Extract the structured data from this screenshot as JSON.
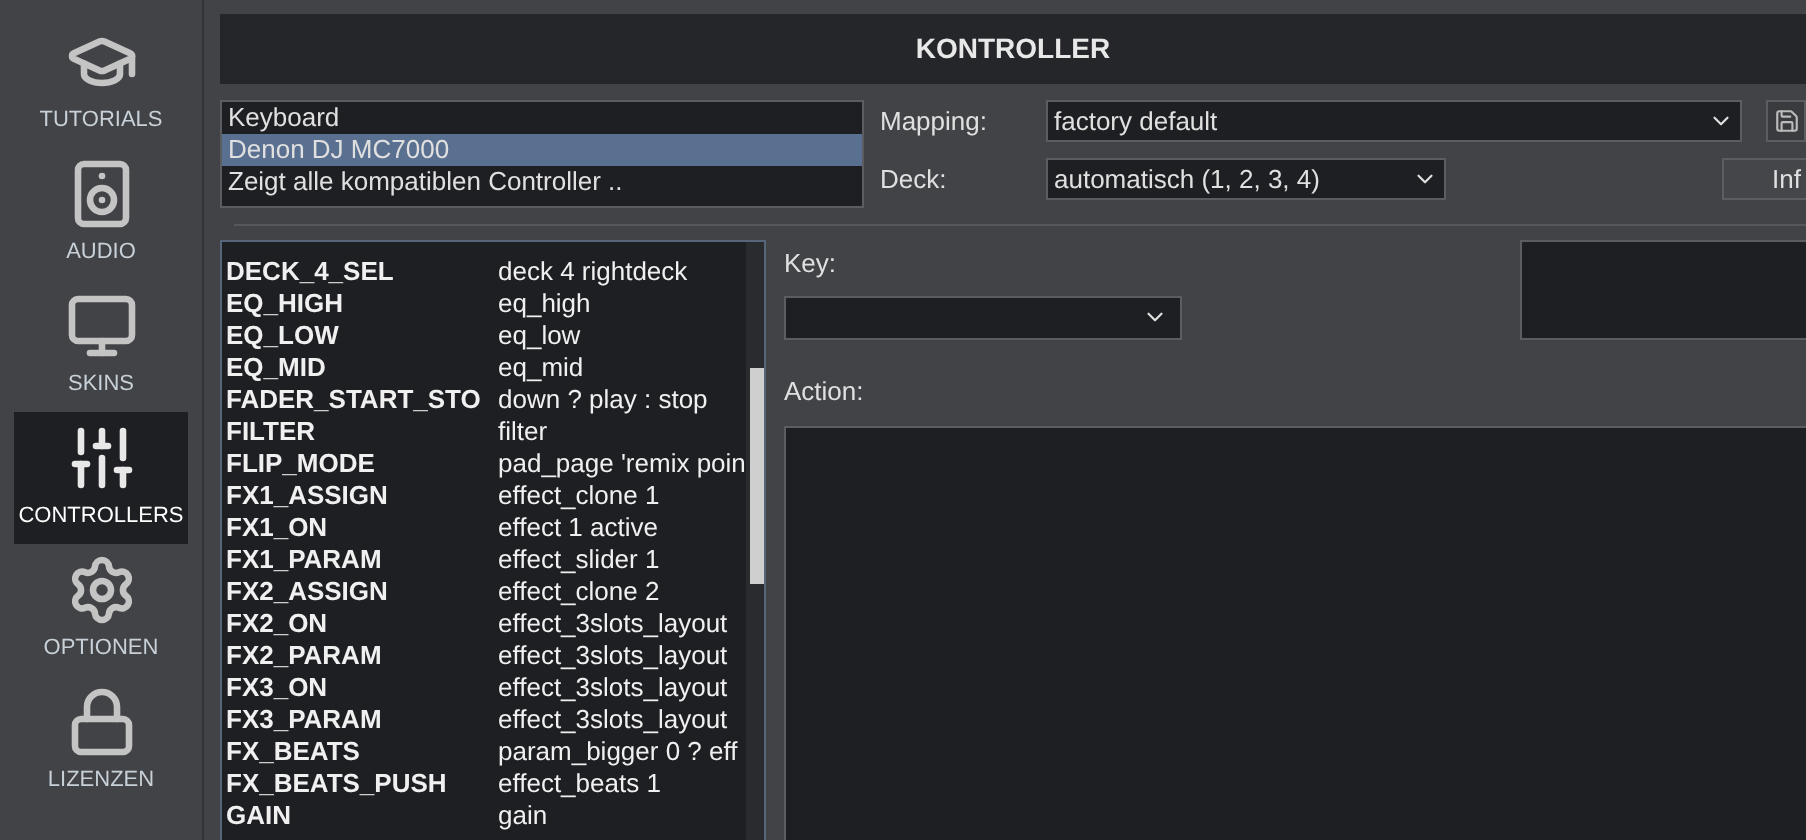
{
  "sidebar": {
    "items": [
      {
        "label": "TUTORIALS",
        "selected": false
      },
      {
        "label": "AUDIO",
        "selected": false
      },
      {
        "label": "SKINS",
        "selected": false
      },
      {
        "label": "CONTROLLERS",
        "selected": true
      },
      {
        "label": "OPTIONEN",
        "selected": false
      },
      {
        "label": "LIZENZEN",
        "selected": false
      }
    ]
  },
  "title": "KONTROLLER",
  "devices": [
    {
      "label": "Keyboard",
      "selected": false
    },
    {
      "label": "Denon DJ MC7000",
      "selected": true
    },
    {
      "label": "Zeigt alle kompatiblen Controller ..",
      "selected": false
    }
  ],
  "mapping": {
    "label": "Mapping:",
    "value": "factory default"
  },
  "deck": {
    "label": "Deck:",
    "value": "automatisch (1, 2, 3, 4)"
  },
  "info_button": "Inf",
  "functions": [
    {
      "key": "DECK_4_SEL",
      "action": "deck 4 rightdeck"
    },
    {
      "key": "EQ_HIGH",
      "action": "eq_high"
    },
    {
      "key": "EQ_LOW",
      "action": "eq_low"
    },
    {
      "key": "EQ_MID",
      "action": "eq_mid"
    },
    {
      "key": "FADER_START_STO",
      "action": "down ? play : stop"
    },
    {
      "key": "FILTER",
      "action": "filter"
    },
    {
      "key": "FLIP_MODE",
      "action": "pad_page 'remix poin"
    },
    {
      "key": "FX1_ASSIGN",
      "action": "effect_clone 1"
    },
    {
      "key": "FX1_ON",
      "action": "effect 1 active"
    },
    {
      "key": "FX1_PARAM",
      "action": "effect_slider 1"
    },
    {
      "key": "FX2_ASSIGN",
      "action": "effect_clone 2"
    },
    {
      "key": "FX2_ON",
      "action": "effect_3slots_layout"
    },
    {
      "key": "FX2_PARAM",
      "action": "effect_3slots_layout"
    },
    {
      "key": "FX3_ON",
      "action": "effect_3slots_layout"
    },
    {
      "key": "FX3_PARAM",
      "action": "effect_3slots_layout"
    },
    {
      "key": "FX_BEATS",
      "action": "param_bigger 0 ? eff"
    },
    {
      "key": "FX_BEATS_PUSH",
      "action": "effect_beats 1"
    },
    {
      "key": "GAIN",
      "action": "gain"
    }
  ],
  "key_field": {
    "label": "Key:"
  },
  "action_field": {
    "label": "Action:"
  }
}
